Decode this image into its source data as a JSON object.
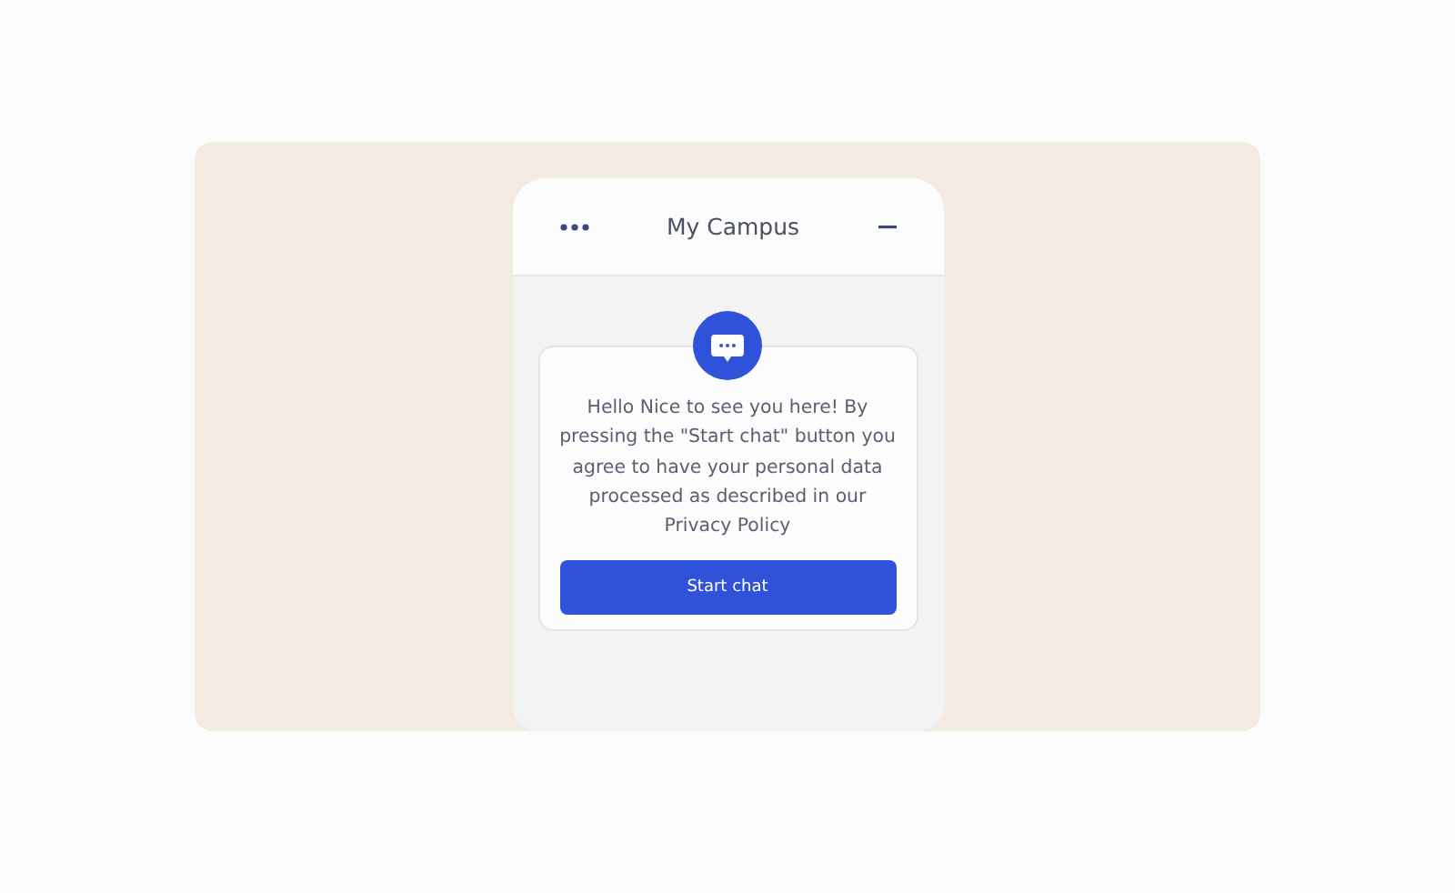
{
  "header": {
    "title": "My Campus"
  },
  "card": {
    "message": "Hello Nice to see you here! By pressing the \"Start chat\" button you agree to have your personal data processed as described in our Privacy Policy",
    "button": "Start chat"
  }
}
